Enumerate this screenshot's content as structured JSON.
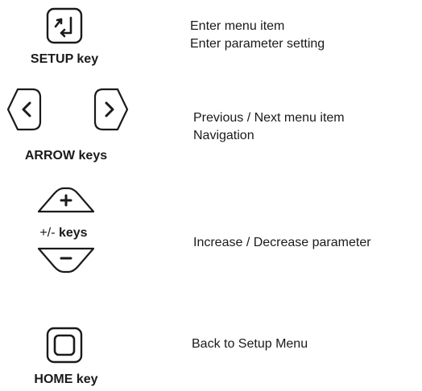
{
  "colors": {
    "stroke": "#1a1a1a",
    "text": "#1a1a1a",
    "background": "#ffffff"
  },
  "keys": [
    {
      "id": "setup",
      "icon": "enter-return-icon",
      "label": "SETUP key",
      "descriptions": [
        "Enter menu item",
        "Enter parameter setting"
      ]
    },
    {
      "id": "arrow",
      "icon": [
        "chevron-left-icon",
        "chevron-right-icon"
      ],
      "label": "ARROW keys",
      "descriptions": [
        "Previous / Next menu item",
        "Navigation"
      ]
    },
    {
      "id": "plusminus",
      "icon": [
        "plus-icon",
        "minus-icon"
      ],
      "label_prefix": "+/- ",
      "label_suffix": "keys",
      "descriptions": [
        "Increase / Decrease parameter"
      ]
    },
    {
      "id": "home",
      "icon": "square-home-icon",
      "label": "HOME key",
      "descriptions": [
        "Back to Setup Menu"
      ]
    }
  ]
}
